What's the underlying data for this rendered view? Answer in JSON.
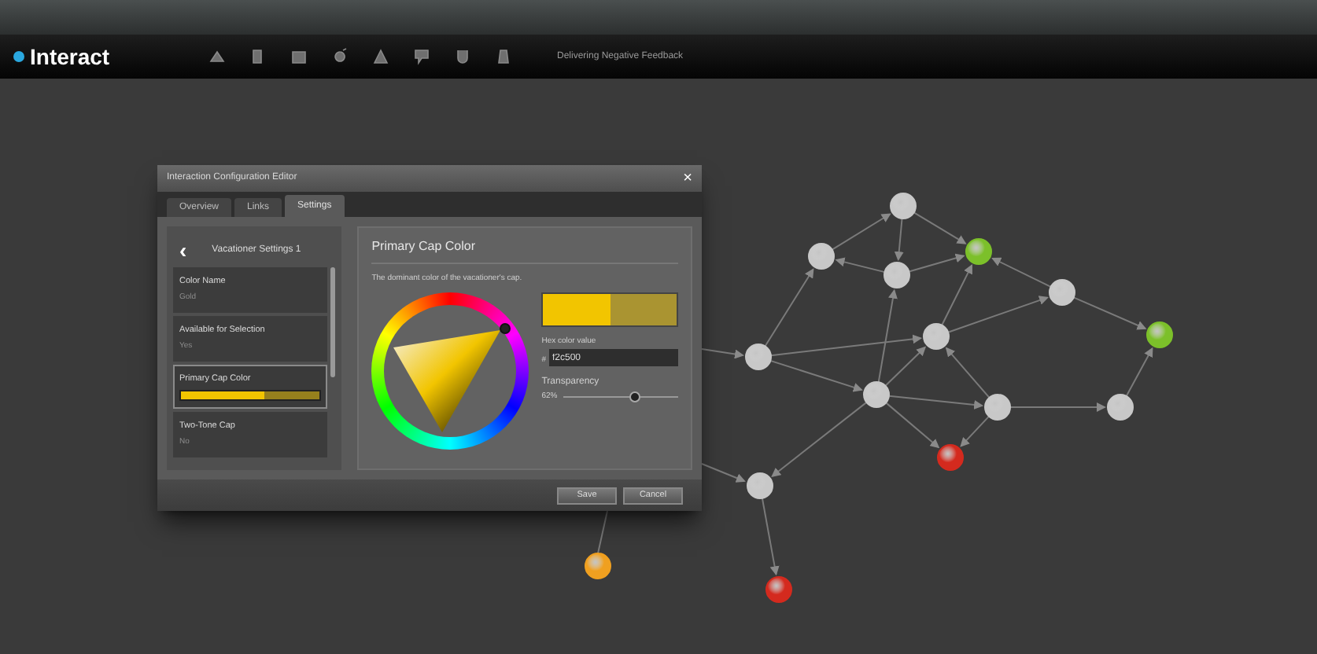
{
  "app": {
    "logo": "Interact",
    "document_title": "Delivering Negative Feedback"
  },
  "dialog": {
    "title": "Interaction Configuration Editor",
    "close": "×",
    "tabs": [
      {
        "label": "Overview",
        "selected": false
      },
      {
        "label": "Links",
        "selected": false
      },
      {
        "label": "Settings",
        "selected": true
      }
    ],
    "back": "‹",
    "section": "Vacationer Settings 1",
    "settings": [
      {
        "label": "Color Name",
        "value": "Gold",
        "selected": false,
        "kind": "text"
      },
      {
        "label": "Available for Selection",
        "value": "Yes",
        "selected": false,
        "kind": "text"
      },
      {
        "label": "Primary Cap Color",
        "selected": true,
        "kind": "color",
        "color": "#f2c500"
      },
      {
        "label": "Two-Tone Cap",
        "value": "No",
        "selected": false,
        "kind": "text"
      }
    ],
    "detail": {
      "heading": "Primary Cap Color",
      "description": "The dominant color of the vacationer's cap.",
      "hex_label": "Hex color value",
      "hex_prefix": "#",
      "hex_value": "f2c500",
      "transparency_label": "Transparency",
      "transparency_reading": "62%",
      "transparency": {
        "level": 0.62
      }
    },
    "buttons": [
      "Save",
      "Cancel"
    ]
  },
  "graph": {
    "nodes": [
      {
        "color": "#c8c8c8"
      },
      {
        "color": "#c8c8c8"
      },
      {
        "color": "#c8c8c8"
      },
      {
        "color": "#7cc02a"
      },
      {
        "color": "#c8c8c8"
      },
      {
        "color": "#7cc02a"
      },
      {
        "color": "#c8c8c8"
      },
      {
        "color": "#c8c8c8"
      },
      {
        "color": "#c8c8c8"
      },
      {
        "color": "#c8c8c8"
      },
      {
        "color": "#c8c8c8"
      },
      {
        "color": "#d42a1e"
      },
      {
        "color": "#c8c8c8"
      },
      {
        "color": "#d42a1e"
      },
      {
        "color": "#f0a020"
      }
    ]
  }
}
